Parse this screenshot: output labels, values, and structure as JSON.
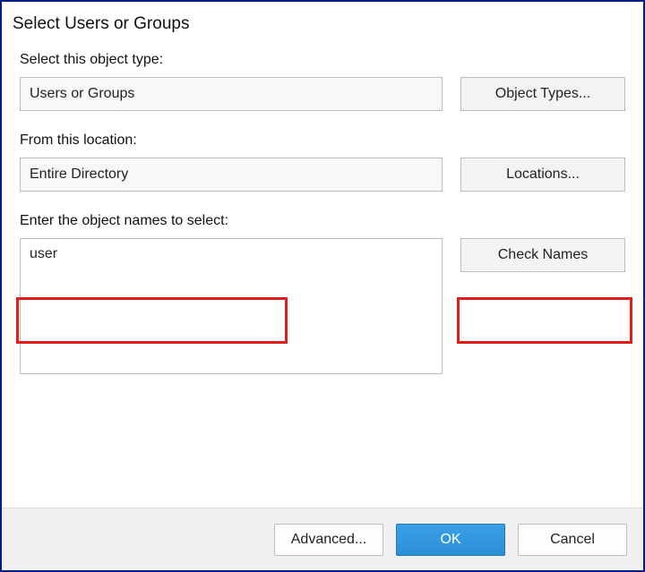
{
  "window": {
    "title": "Select Users or Groups"
  },
  "section1": {
    "label": "Select this object type:",
    "value": "Users or Groups",
    "button": "Object Types..."
  },
  "section2": {
    "label": "From this location:",
    "value": "Entire Directory",
    "button": "Locations..."
  },
  "section3": {
    "label": "Enter the object names to select:",
    "value": "user",
    "button": "Check Names"
  },
  "footer": {
    "advanced": "Advanced...",
    "ok": "OK",
    "cancel": "Cancel"
  }
}
